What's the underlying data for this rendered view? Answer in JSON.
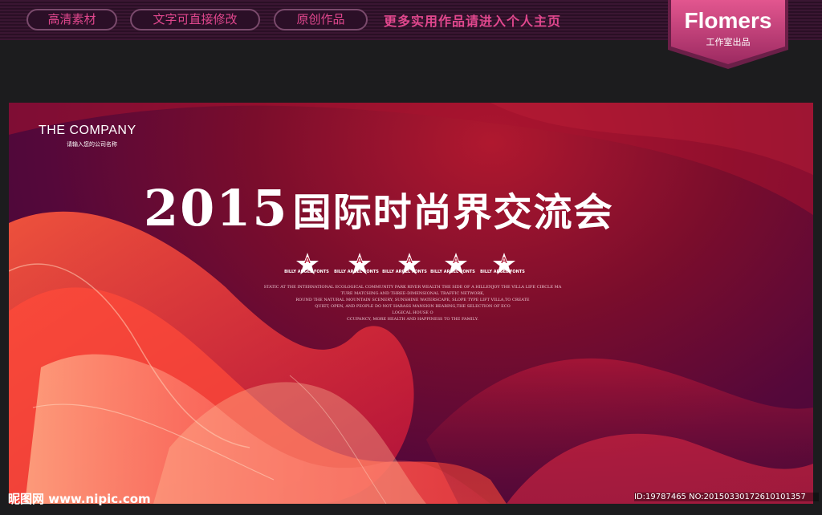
{
  "topbar": {
    "tags": [
      "高清素材",
      "文字可直接修改",
      "原创作品"
    ],
    "promo": "更多实用作品请进入个人主页"
  },
  "brand": {
    "name": "Flomers",
    "subtitle": "工作室出品"
  },
  "poster": {
    "company": "THE COMPANY",
    "company_sub": "请输入您的公司名称",
    "year": "2015",
    "title": "国际时尚界交流会",
    "star_letter": "A",
    "font_labels": [
      "BILLY ARGEL FONTS",
      "BILLY ARGEL FONTS",
      "BILLY ARGEL FONTS",
      "BILLY ARGEL FONTS",
      "BILLY ARGEL FONTS"
    ],
    "paragraph": [
      "STATIC AT THE INTERNATIONAL ECOLOGICAL COMMUNITY PARK RIVER WEALTH THE SIDE OF A HILLENJOY THE VILLA LIFE CIRCLE MA",
      "TURE MATCHING AND THREE-DIMENSIONAL TRAFFIC NETWORK,",
      "ROUND THE NATURAL MOUNTAIN SCENERY, SUNSHINE WATERSCAPE, SLOPE TYPE LIFT VILLA,TO CREATE",
      "QUIET, OPEN, AND PEOPLE DO NOT HARASS MANSION BEARING,THE SELECTION OF ECO",
      "LOGICAL HOUSE O",
      "CCUPANCY, MORE HEALTH AND HAPPINESS TO THE FAMILY."
    ]
  },
  "footer": {
    "watermark": "昵图网 www.nipic.com",
    "id_text": "ID:19787465 NO:20150330172610101357"
  },
  "colors": {
    "accent": "#e0478d",
    "poster_red": "#b0182f",
    "poster_purple": "#55083a"
  }
}
